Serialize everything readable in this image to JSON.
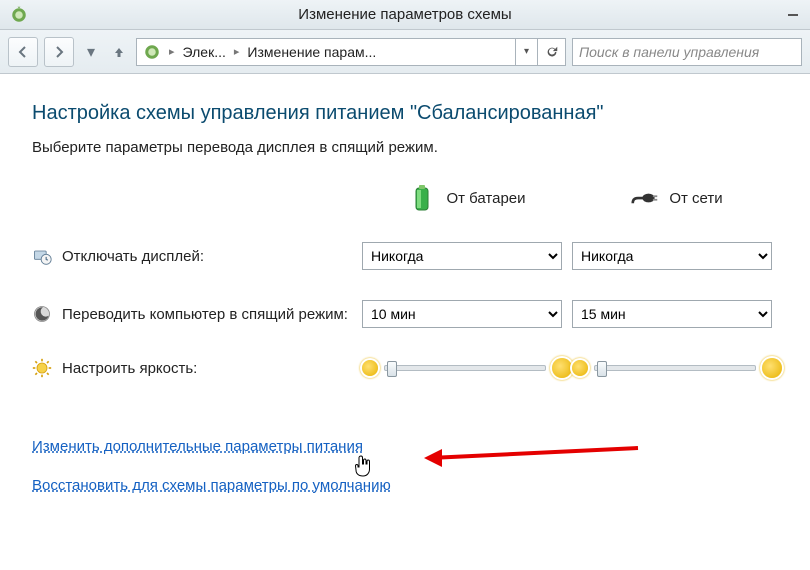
{
  "titlebar": {
    "title": "Изменение параметров схемы"
  },
  "toolbar": {
    "breadcrumb": {
      "seg1": "Элек...",
      "seg2": "Изменение парам..."
    },
    "search_placeholder": "Поиск в панели управления"
  },
  "content": {
    "heading": "Настройка схемы управления питанием \"Сбалансированная\"",
    "instruction": "Выберите параметры перевода дисплея в спящий режим.",
    "columns": {
      "battery": "От батареи",
      "plugged": "От сети"
    },
    "rows": {
      "display_off": {
        "label": "Отключать дисплей:",
        "battery_value": "Никогда",
        "plugged_value": "Никогда"
      },
      "sleep": {
        "label": "Переводить компьютер в спящий режим:",
        "battery_value": "10 мин",
        "plugged_value": "15 мин"
      },
      "brightness": {
        "label": "Настроить яркость:"
      }
    },
    "links": {
      "advanced": "Изменить дополнительные параметры питания",
      "restore": "Восстановить для схемы параметры по умолчанию"
    }
  }
}
